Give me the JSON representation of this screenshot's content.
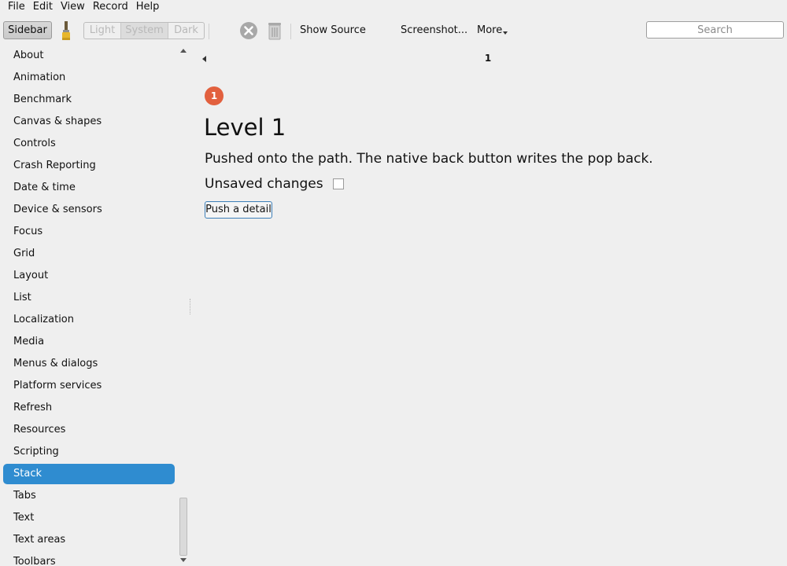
{
  "menubar": {
    "items": [
      "File",
      "Edit",
      "View",
      "Record",
      "Help"
    ]
  },
  "toolbar": {
    "sidebar_label": "Sidebar",
    "appearance": {
      "light": "Light",
      "system": "System",
      "dark": "Dark",
      "selected": "System"
    },
    "show_source_label": "Show Source",
    "screenshot_label": "Screenshot...",
    "more_label": "More",
    "search_placeholder": "Search"
  },
  "sidebar": {
    "selected": "Stack",
    "items": [
      "About",
      "Animation",
      "Benchmark",
      "Canvas & shapes",
      "Controls",
      "Crash Reporting",
      "Date & time",
      "Device & sensors",
      "Focus",
      "Grid",
      "Layout",
      "List",
      "Localization",
      "Media",
      "Menus & dialogs",
      "Platform services",
      "Refresh",
      "Resources",
      "Scripting",
      "Stack",
      "Tabs",
      "Text",
      "Text areas",
      "Toolbars"
    ]
  },
  "main": {
    "path_count": "1",
    "badge": "1",
    "title": "Level 1",
    "description": "Pushed onto the path. The native back button writes the pop back.",
    "unsaved_label": "Unsaved changes",
    "unsaved_checked": false,
    "push_button_label": "Push a detail"
  },
  "colors": {
    "accent": "#2f8cd0",
    "badge": "#e2603e"
  }
}
